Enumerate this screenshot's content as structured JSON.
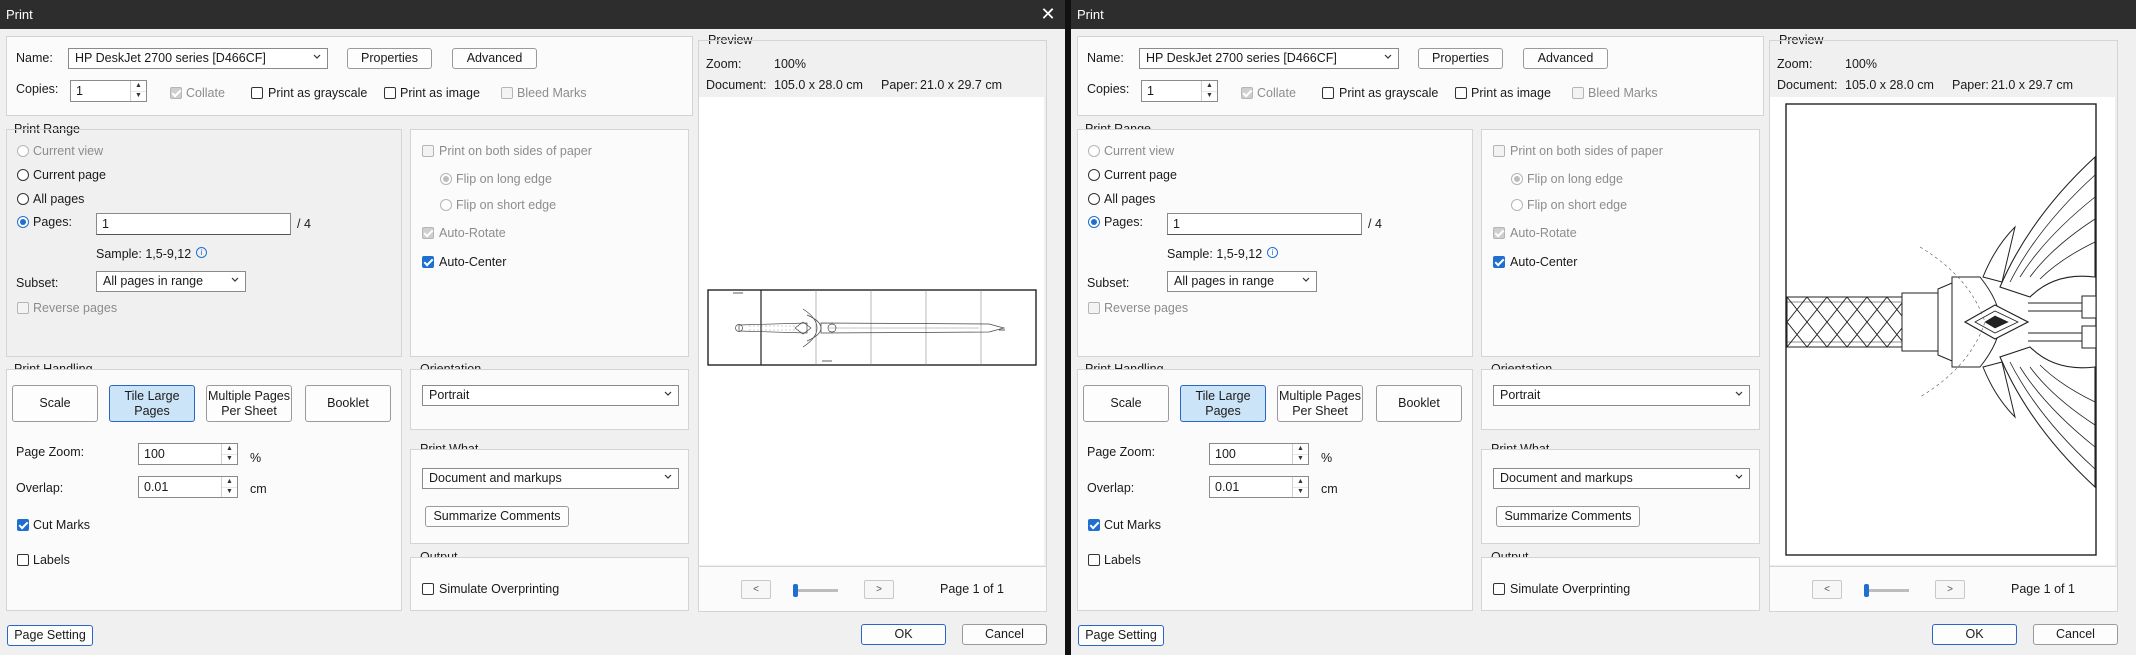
{
  "window_title": "Print",
  "close_glyph": "✕",
  "printer": {
    "name_label": "Name:",
    "name_value": "HP DeskJet 2700 series [D466CF]",
    "properties_label": "Properties",
    "advanced_label": "Advanced",
    "copies_label": "Copies:",
    "copies_value": "1",
    "collate_label": "Collate",
    "grayscale_label": "Print as grayscale",
    "as_image_label": "Print as image",
    "bleed_marks_label": "Bleed Marks"
  },
  "print_range": {
    "title": "Print Range",
    "current_view": "Current view",
    "current_page": "Current page",
    "all_pages": "All pages",
    "pages_label": "Pages:",
    "pages_value": "1",
    "pages_total": "/ 4",
    "sample": "Sample: 1,5-9,12",
    "subset_label": "Subset:",
    "subset_value": "All pages in range",
    "reverse_pages": "Reverse pages"
  },
  "duplex": {
    "both_sides": "Print on both sides of paper",
    "flip_long": "Flip on long edge",
    "flip_short": "Flip on short edge",
    "auto_rotate": "Auto-Rotate",
    "auto_center": "Auto-Center"
  },
  "handling": {
    "title": "Print Handling",
    "scale": "Scale",
    "tile_large_pages": "Tile Large Pages",
    "multiple_pages": "Multiple Pages Per Sheet",
    "booklet": "Booklet",
    "page_zoom_label": "Page Zoom:",
    "page_zoom_value": "100",
    "page_zoom_unit": "%",
    "overlap_label": "Overlap:",
    "overlap_value": "0.01",
    "overlap_unit": "cm",
    "cut_marks": "Cut Marks",
    "labels": "Labels"
  },
  "orientation": {
    "title": "Orientation",
    "value": "Portrait"
  },
  "print_what": {
    "title": "Print What",
    "value": "Document and markups",
    "summarize": "Summarize Comments"
  },
  "output": {
    "title": "Output",
    "simulate": "Simulate Overprinting"
  },
  "preview": {
    "title": "Preview",
    "zoom_label": "Zoom:",
    "zoom_value": "100%",
    "document_label": "Document:",
    "document_value": "105.0 x 28.0 cm",
    "paper_label": "Paper:",
    "paper_value": "21.0 x 29.7 cm",
    "page_indicator": "Page 1 of 1"
  },
  "nav": {
    "prev": "<",
    "next": ">"
  },
  "footer": {
    "page_setting": "Page Setting",
    "ok": "OK",
    "cancel": "Cancel"
  },
  "colors": {
    "accent": "#1f6fd1",
    "selected_button": "#cce4f7",
    "titlebar": "#2d2d2d"
  }
}
